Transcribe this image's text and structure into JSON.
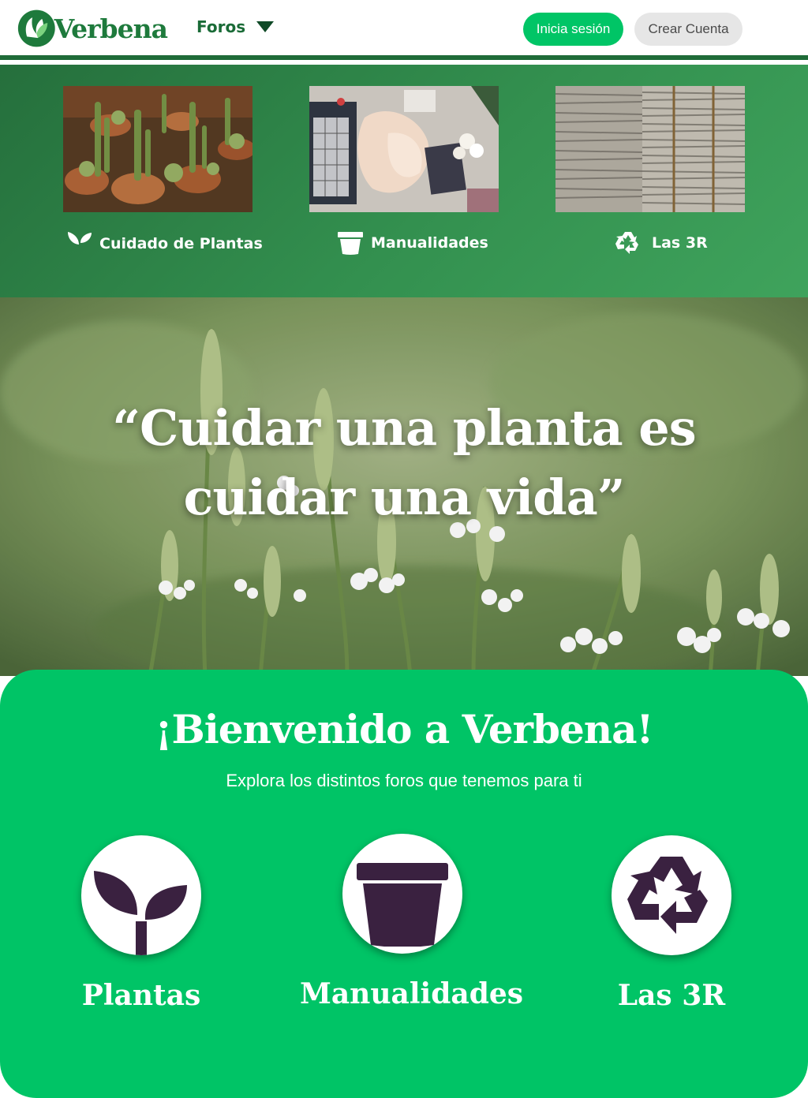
{
  "brand": {
    "name": "Verbena",
    "primary": "#00c466",
    "dark": "#1f6b38",
    "accent_dark": "#3a2140"
  },
  "nav": {
    "foros_label": "Foros",
    "login_label": "Inicia sesión",
    "signup_label": "Crear Cuenta"
  },
  "dropdown": {
    "items": [
      {
        "label": "Cuidado de Plantas",
        "icon": "sprout-icon"
      },
      {
        "label": "Manualidades",
        "icon": "flowerpot-icon"
      },
      {
        "label": "Las 3R",
        "icon": "recycle-icon"
      }
    ]
  },
  "hero": {
    "quote": "“Cuidar una planta es cuidar una vida”"
  },
  "welcome": {
    "title": "¡Bienvenido a Verbena!",
    "subtitle": "Explora los distintos foros que tenemos para ti",
    "categories": [
      {
        "label": "Plantas",
        "icon": "sprout-icon"
      },
      {
        "label": "Manualidades",
        "icon": "flowerpot-icon"
      },
      {
        "label": "Las 3R",
        "icon": "recycle-icon"
      }
    ]
  }
}
